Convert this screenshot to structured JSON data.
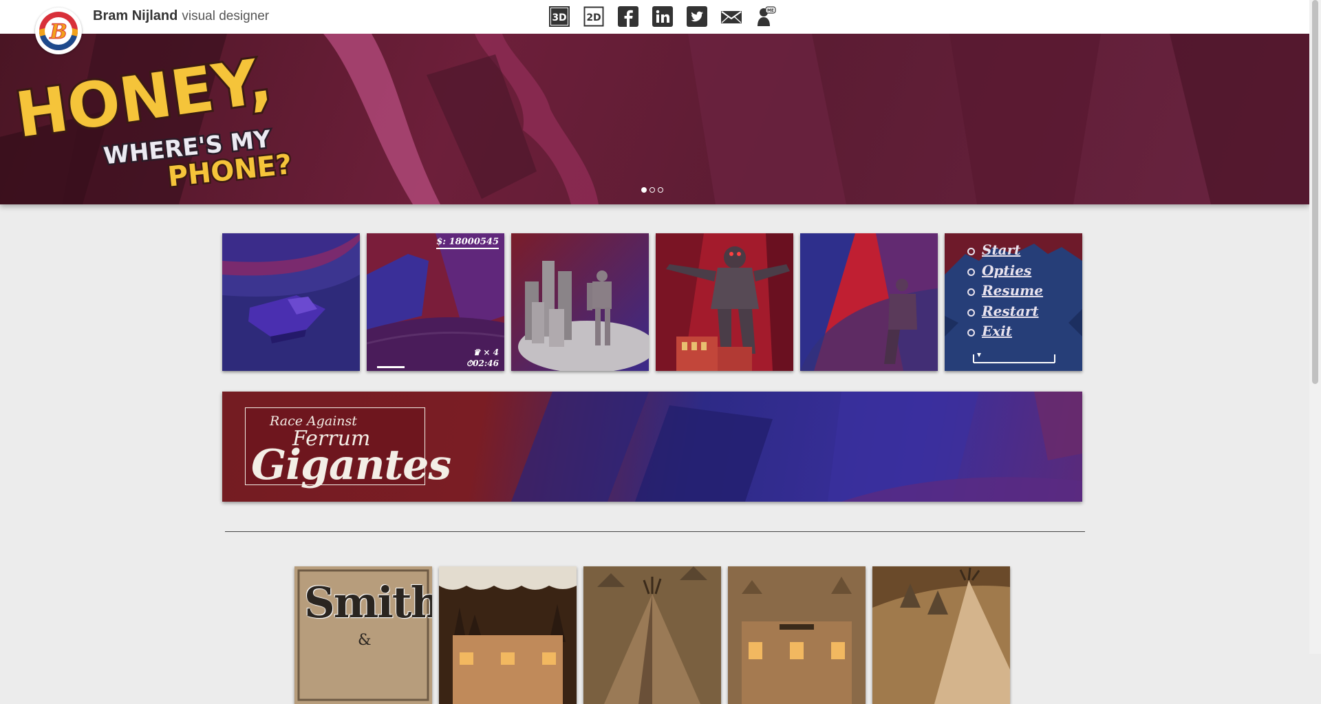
{
  "header": {
    "logo_letter": "B",
    "name": "Bram Nijland",
    "role": "visual designer",
    "icons": [
      {
        "name": "3d-icon",
        "label": "3D"
      },
      {
        "name": "2d-icon",
        "label": "2D"
      },
      {
        "name": "facebook-icon",
        "label": "f"
      },
      {
        "name": "linkedin-icon",
        "label": "in"
      },
      {
        "name": "twitter-icon",
        "label": ""
      },
      {
        "name": "mail-icon",
        "label": ""
      },
      {
        "name": "about-me-icon",
        "label": "ME"
      }
    ]
  },
  "hero": {
    "title_line1": "HONEY,",
    "title_line2": "WHERE'S MY",
    "title_line3": "PHONE?",
    "slide_count": 3,
    "active_slide": 0
  },
  "thumbs": {
    "score": "$: 18000545",
    "lives": "× 4",
    "time": "02:46",
    "menu": [
      "Start",
      "Opties",
      "Resume",
      "Restart",
      "Exit"
    ]
  },
  "banner": {
    "line1": "Race Against",
    "line2": "Ferrum",
    "line3": "Gigantes"
  },
  "row2": {
    "smith_title": "Smith",
    "smith_amp": "&"
  },
  "colors": {
    "hero_bg": "#5c1c33",
    "logo_orange": "#f2a21c",
    "logo_red": "#d8303a",
    "logo_blue": "#1e4a8c",
    "title_yellow": "#f5c43a"
  }
}
